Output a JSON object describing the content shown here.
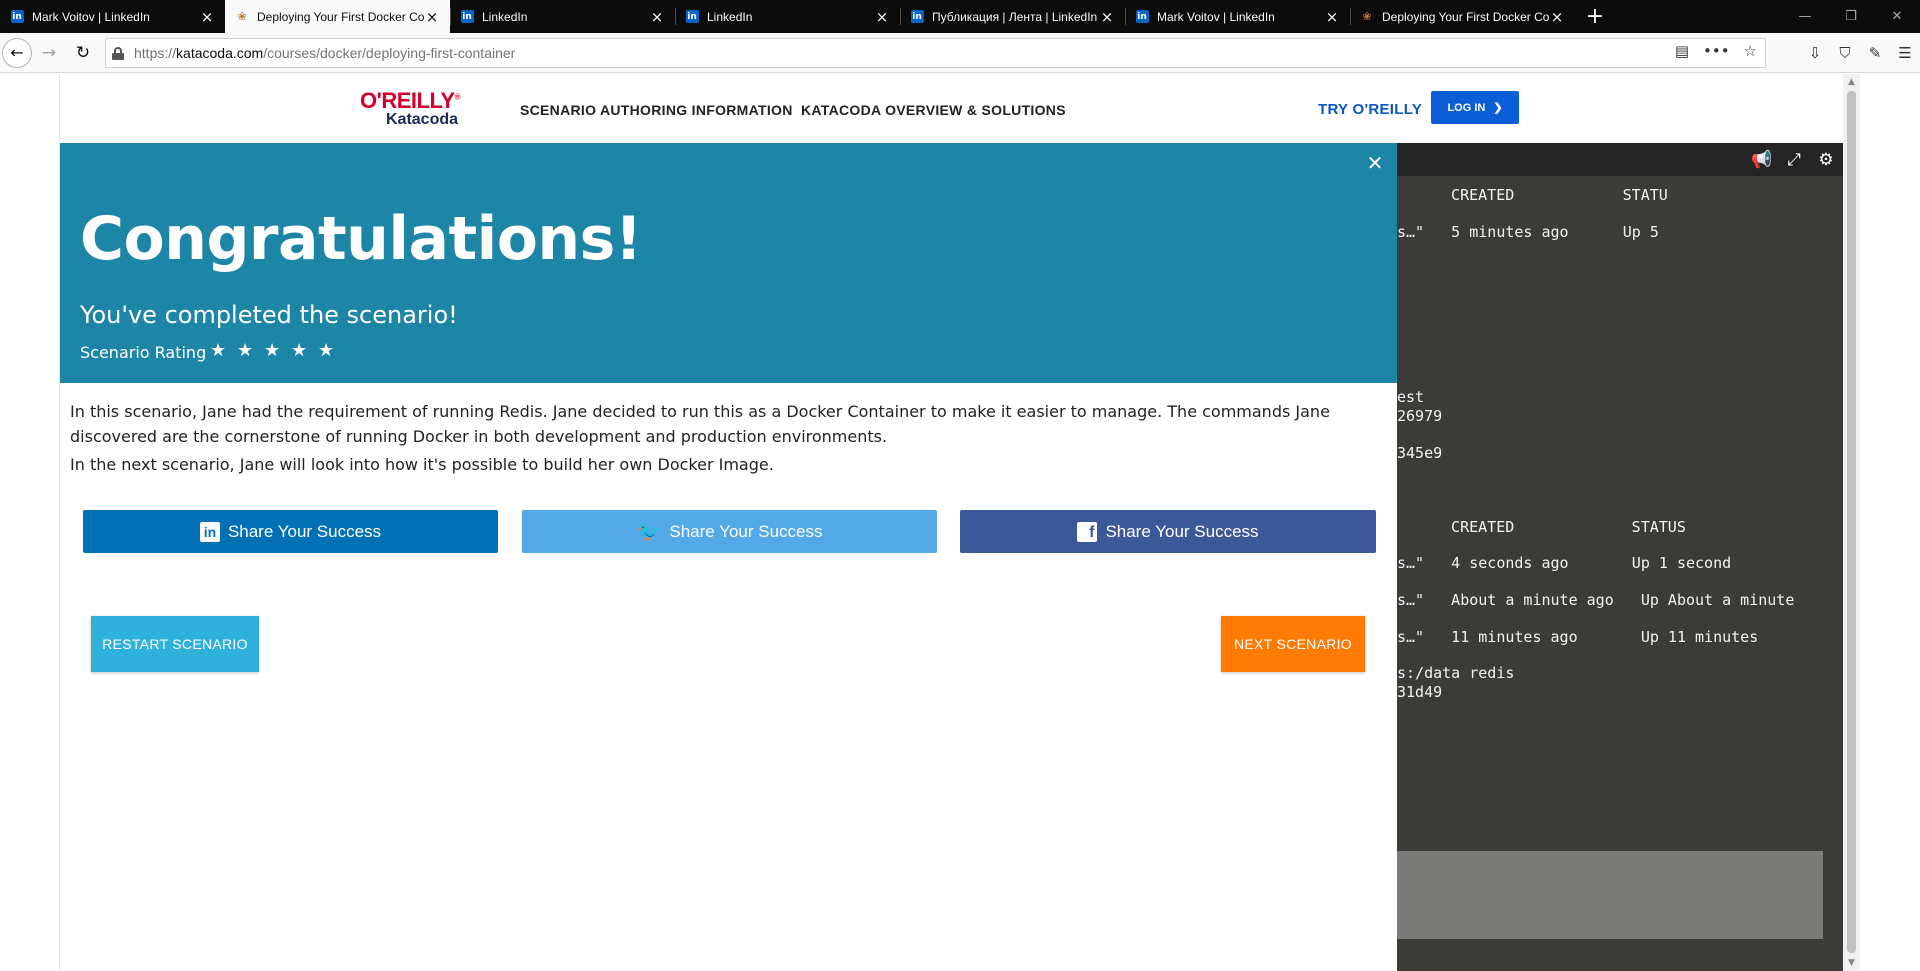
{
  "browser": {
    "tabs": [
      {
        "title": "Mark Voitov | LinkedIn",
        "icon": "linkedin-icon",
        "active": false
      },
      {
        "title": "Deploying Your First Docker Co",
        "icon": "katacoda-icon",
        "active": true
      },
      {
        "title": "LinkedIn",
        "icon": "linkedin-icon",
        "active": false
      },
      {
        "title": "LinkedIn",
        "icon": "linkedin-icon",
        "active": false
      },
      {
        "title": "Публикация | Лента | LinkedIn",
        "icon": "linkedin-icon",
        "active": false
      },
      {
        "title": "Mark Voitov | LinkedIn",
        "icon": "linkedin-icon",
        "active": false
      },
      {
        "title": "Deploying Your First Docker Co",
        "icon": "katacoda-icon",
        "active": false
      }
    ],
    "url_prefix": "https://",
    "url_host": "katacoda.com",
    "url_path": "/courses/docker/deploying-first-container"
  },
  "site": {
    "logo_top": "O'REILLY",
    "logo_reg": "®",
    "logo_bottom": "Katacoda",
    "nav": [
      "SCENARIO AUTHORING INFORMATION",
      "KATACODA OVERVIEW & SOLUTIONS"
    ],
    "try_link": "TRY O'REILLY",
    "login_label": "LOG IN"
  },
  "modal": {
    "title": "Congratulations!",
    "subtitle": "You've completed the scenario!",
    "rating_label": "Scenario Rating",
    "rating_stars": 5,
    "paragraph1": "In this scenario, Jane had the requirement of running Redis. Jane decided to run this as a Docker Container to make it easier to manage. The commands Jane discovered are the cornerstone of running Docker in both development and production environments.",
    "paragraph2": "In the next scenario, Jane will look into how it's possible to build her own Docker Image.",
    "share_linkedin": "Share Your Success",
    "share_twitter": "Share Your Success",
    "share_facebook": "Share Your Success",
    "restart_label": "RESTART SCENARIO",
    "next_label": "NEXT SCENARIO",
    "colors": {
      "banner": "#1d85a6",
      "linkedin": "#0270b5",
      "twitter": "#53a9e8",
      "facebook": "#3b5998",
      "restart": "#30b1dc",
      "next": "#ff7b03"
    }
  },
  "terminal": {
    "lines": [
      {
        "text": "  CREATED            STATU"
      },
      {
        "text": "s…\"   5 minutes ago      Up 5"
      },
      {
        "text": "est"
      },
      {
        "text": "26979"
      },
      {
        "text": "345e9"
      },
      {
        "text": "  CREATED             STATUS"
      },
      {
        "text": "s…\"   4 seconds ago       Up 1 second"
      },
      {
        "text": "s…\"   About a minute ago   Up About a minute"
      },
      {
        "text": "s…\"   11 minutes ago       Up 11 minutes"
      },
      {
        "text": "s:/data redis"
      },
      {
        "text": "31d49"
      }
    ]
  }
}
